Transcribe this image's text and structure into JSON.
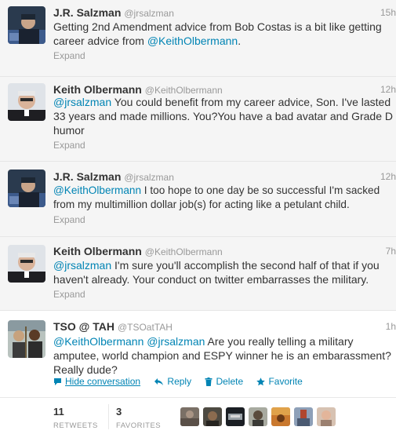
{
  "tweets": [
    {
      "name": "J.R. Salzman",
      "handle": "@jrsalzman",
      "time": "15h",
      "avatar": "jr-salzman-avatar",
      "text_parts": [
        "Getting 2nd Amendment advice from Bob Costas is a bit like getting career advice from ",
        "@KeithOlbermann",
        "."
      ],
      "expand": "Expand"
    },
    {
      "name": "Keith Olbermann",
      "handle": "@KeithOlbermann",
      "time": "12h",
      "avatar": "keith-olbermann-avatar",
      "text_parts": [
        "@jrsalzman",
        " You could benefit from my career advice, Son. I've lasted 33 years and made millions. You?You have a bad avatar and Grade D humor"
      ],
      "expand": "Expand"
    },
    {
      "name": "J.R. Salzman",
      "handle": "@jrsalzman",
      "time": "12h",
      "avatar": "jr-salzman-avatar",
      "text_parts": [
        "@KeithOlbermann",
        " I too hope to one day be so successful I'm sacked from my multimillion dollar job(s) for acting like a petulant child."
      ],
      "expand": "Expand"
    },
    {
      "name": "Keith Olbermann",
      "handle": "@KeithOlbermann",
      "time": "7h",
      "avatar": "keith-olbermann-avatar",
      "text_parts": [
        "@jrsalzman",
        " I'm sure you'll accomplish the second half of that if you haven't already. Your conduct on twitter embarrasses the military."
      ],
      "expand": "Expand"
    },
    {
      "name": "TSO @ TAH",
      "handle": "@TSOatTAH",
      "time": "1h",
      "avatar": "tso-avatar",
      "text_parts": [
        "@KeithOlbermann",
        " ",
        "@jrsalzman",
        " Are you really telling a military amputee, world champion and ESPY winner he is an embarassment? Really dude?"
      ]
    }
  ],
  "actions": {
    "hide_conversation": "Hide conversation",
    "reply": "Reply",
    "delete": "Delete",
    "favorite": "Favorite"
  },
  "stats": {
    "retweets_count": "11",
    "retweets_label": "RETWEETS",
    "favorites_count": "3",
    "favorites_label": "FAVORITES"
  },
  "favoriter_avatars": [
    "favoriter-avatar-1",
    "favoriter-avatar-2",
    "favoriter-avatar-3",
    "favoriter-avatar-4",
    "favoriter-avatar-5",
    "favoriter-avatar-6",
    "favoriter-avatar-7"
  ],
  "colors": {
    "link": "#0084b4",
    "muted": "#999999",
    "text": "#333333",
    "collapsed_bg": "#f5f5f5"
  }
}
